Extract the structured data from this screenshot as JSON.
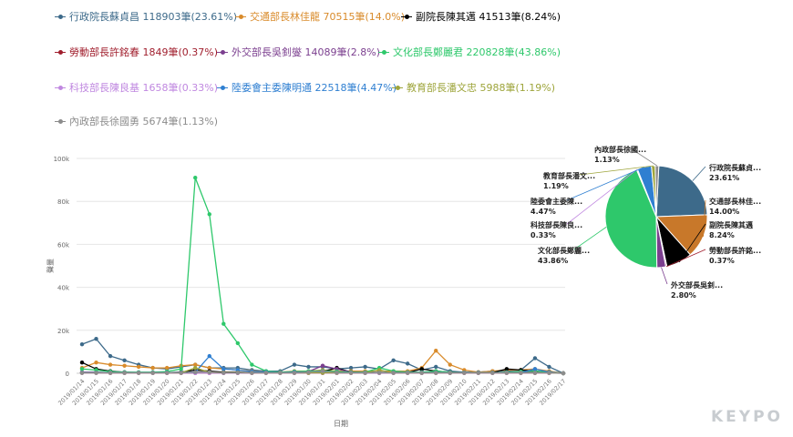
{
  "legend": [
    {
      "name": "行政院長蘇貞昌",
      "text": "行政院長蘇貞昌 118903筆(23.61%)",
      "color": "#3d6a8a"
    },
    {
      "name": "交通部長林佳龍",
      "text": "交通部長林佳龍 70515筆(14.0%)",
      "color": "#d98b2b"
    },
    {
      "name": "副院長陳其邁",
      "text": "副院長陳其邁 41513筆(8.24%)",
      "color": "#000000"
    },
    {
      "name": "勞動部長許銘春",
      "text": "勞動部長許銘春 1849筆(0.37%)",
      "color": "#a01e2d"
    },
    {
      "name": "外交部長吳釗燮",
      "text": "外交部長吳釗燮 14089筆(2.8%)",
      "color": "#7b3f8f"
    },
    {
      "name": "文化部長鄭麗君",
      "text": "文化部長鄭麗君 220828筆(43.86%)",
      "color": "#2ec86b"
    },
    {
      "name": "科技部長陳良基",
      "text": "科技部長陳良基 1658筆(0.33%)",
      "color": "#c088e0"
    },
    {
      "name": "陸委會主委陳明通",
      "text": "陸委會主委陳明通 22518筆(4.47%)",
      "color": "#2f7fd1"
    },
    {
      "name": "教育部長潘文忠",
      "text": "教育部長潘文忠 5988筆(1.19%)",
      "color": "#9ea53c"
    },
    {
      "name": "內政部長徐國勇",
      "text": "內政部長徐國勇 5674筆(1.13%)",
      "color": "#8c8c8c"
    }
  ],
  "logo": "KEYPO",
  "chart_data": [
    {
      "type": "line",
      "xlabel": "日期",
      "ylabel": "聲量",
      "ylim": [
        0,
        100000
      ],
      "yticks": [
        0,
        20000,
        40000,
        60000,
        80000,
        100000
      ],
      "ytick_labels": [
        "0",
        "20k",
        "40k",
        "60k",
        "80k",
        "100k"
      ],
      "grid": true,
      "categories": [
        "2019/01/14",
        "2019/01/15",
        "2019/01/16",
        "2019/01/17",
        "2019/01/18",
        "2019/01/19",
        "2019/01/20",
        "2019/01/21",
        "2019/01/22",
        "2019/01/23",
        "2019/01/24",
        "2019/01/25",
        "2019/01/26",
        "2019/01/27",
        "2019/01/28",
        "2019/01/29",
        "2019/01/30",
        "2019/01/31",
        "2019/02/01",
        "2019/02/02",
        "2019/02/03",
        "2019/02/04",
        "2019/02/05",
        "2019/02/06",
        "2019/02/07",
        "2019/02/08",
        "2019/02/09",
        "2019/02/10",
        "2019/02/11",
        "2019/02/12",
        "2019/02/13",
        "2019/02/14",
        "2019/02/15",
        "2019/02/16",
        "2019/02/17"
      ],
      "series": [
        {
          "name": "行政院長蘇貞昌",
          "color": "#3d6a8a",
          "values": [
            13500,
            16000,
            8000,
            6000,
            4000,
            2500,
            2000,
            3000,
            4000,
            2500,
            2500,
            2500,
            1500,
            1000,
            1000,
            4000,
            3000,
            3000,
            2000,
            2500,
            3000,
            2000,
            6000,
            4500,
            1500,
            3000,
            1000,
            500,
            500,
            1000,
            1000,
            1500,
            7000,
            3000,
            0
          ]
        },
        {
          "name": "交通部長林佳龍",
          "color": "#d98b2b",
          "values": [
            2500,
            5000,
            4000,
            3500,
            3000,
            2500,
            2500,
            3500,
            4000,
            2500,
            2000,
            1500,
            1000,
            500,
            500,
            1000,
            1000,
            1500,
            1000,
            1000,
            1000,
            1000,
            1000,
            1000,
            2500,
            10500,
            4000,
            1500,
            500,
            1000,
            1500,
            1500,
            2000,
            1000,
            0
          ]
        },
        {
          "name": "副院長陳其邁",
          "color": "#000000",
          "values": [
            5000,
            2000,
            1000,
            500,
            300,
            300,
            300,
            500,
            1500,
            1000,
            500,
            500,
            300,
            300,
            300,
            500,
            500,
            800,
            2500,
            500,
            300,
            300,
            300,
            300,
            2000,
            1000,
            500,
            300,
            300,
            300,
            2000,
            1500,
            1000,
            500,
            0
          ]
        },
        {
          "name": "勞動部長許銘春",
          "color": "#a01e2d",
          "values": [
            200,
            200,
            100,
            100,
            100,
            100,
            100,
            100,
            100,
            100,
            100,
            100,
            100,
            100,
            100,
            100,
            100,
            100,
            100,
            100,
            100,
            100,
            100,
            100,
            100,
            100,
            100,
            100,
            100,
            100,
            100,
            100,
            100,
            100,
            0
          ]
        },
        {
          "name": "外交部長吳釗燮",
          "color": "#7b3f8f",
          "values": [
            500,
            500,
            300,
            300,
            200,
            200,
            200,
            300,
            500,
            500,
            300,
            300,
            200,
            200,
            200,
            300,
            800,
            3500,
            2000,
            500,
            300,
            300,
            300,
            300,
            200,
            300,
            200,
            200,
            200,
            200,
            200,
            300,
            500,
            300,
            0
          ]
        },
        {
          "name": "文化部長鄭麗君",
          "color": "#2ec86b",
          "values": [
            2000,
            1500,
            800,
            500,
            500,
            500,
            800,
            2000,
            91000,
            74000,
            23000,
            14000,
            4000,
            1000,
            500,
            800,
            1000,
            1200,
            800,
            500,
            500,
            2500,
            1000,
            500,
            500,
            1000,
            500,
            300,
            300,
            300,
            500,
            800,
            1000,
            500,
            0
          ]
        },
        {
          "name": "科技部長陳良基",
          "color": "#c088e0",
          "values": [
            100,
            100,
            100,
            100,
            100,
            100,
            100,
            100,
            100,
            100,
            100,
            100,
            100,
            100,
            100,
            100,
            100,
            100,
            100,
            100,
            100,
            100,
            100,
            100,
            100,
            100,
            100,
            100,
            100,
            100,
            100,
            100,
            100,
            100,
            0
          ]
        },
        {
          "name": "陸委會主委陳明通",
          "color": "#2f7fd1",
          "values": [
            300,
            300,
            300,
            300,
            300,
            300,
            300,
            300,
            500,
            8000,
            2000,
            1500,
            800,
            500,
            300,
            500,
            500,
            500,
            300,
            300,
            300,
            300,
            300,
            300,
            300,
            300,
            300,
            300,
            300,
            300,
            300,
            300,
            2000,
            500,
            0
          ]
        },
        {
          "name": "教育部長潘文忠",
          "color": "#9ea53c",
          "values": [
            200,
            200,
            200,
            200,
            200,
            200,
            200,
            200,
            2500,
            500,
            300,
            300,
            200,
            200,
            200,
            200,
            200,
            200,
            200,
            200,
            200,
            1500,
            200,
            200,
            200,
            200,
            200,
            200,
            200,
            200,
            200,
            200,
            200,
            200,
            0
          ]
        },
        {
          "name": "內政部長徐國勇",
          "color": "#8c8c8c",
          "values": [
            200,
            200,
            200,
            200,
            200,
            200,
            200,
            200,
            500,
            500,
            200,
            200,
            200,
            200,
            200,
            200,
            500,
            1000,
            300,
            200,
            200,
            200,
            200,
            200,
            200,
            200,
            200,
            200,
            200,
            200,
            200,
            200,
            200,
            200,
            0
          ]
        }
      ]
    },
    {
      "type": "pie",
      "slices": [
        {
          "label": "行政院長蘇貞...",
          "pct": "23.61%",
          "value": 23.61,
          "color": "#3d6a8a"
        },
        {
          "label": "交通部長林佳...",
          "pct": "14.00%",
          "value": 14.0,
          "color": "#c8782a"
        },
        {
          "label": "副院長陳其邁",
          "pct": "8.24%",
          "value": 8.24,
          "color": "#000000"
        },
        {
          "label": "勞動部長許銘...",
          "pct": "0.37%",
          "value": 0.37,
          "color": "#a01e2d"
        },
        {
          "label": "外交部長吳釗...",
          "pct": "2.80%",
          "value": 2.8,
          "color": "#7b3f8f"
        },
        {
          "label": "文化部長鄭麗...",
          "pct": "43.86%",
          "value": 43.86,
          "color": "#2ec86b"
        },
        {
          "label": "科技部長陳良...",
          "pct": "0.33%",
          "value": 0.33,
          "color": "#c088e0"
        },
        {
          "label": "陸委會主委陳...",
          "pct": "4.47%",
          "value": 4.47,
          "color": "#2f7fd1"
        },
        {
          "label": "教育部長潘文...",
          "pct": "1.19%",
          "value": 1.19,
          "color": "#9ea53c"
        },
        {
          "label": "內政部長徐國...",
          "pct": "1.13%",
          "value": 1.13,
          "color": "#8c8c8c"
        }
      ]
    }
  ]
}
